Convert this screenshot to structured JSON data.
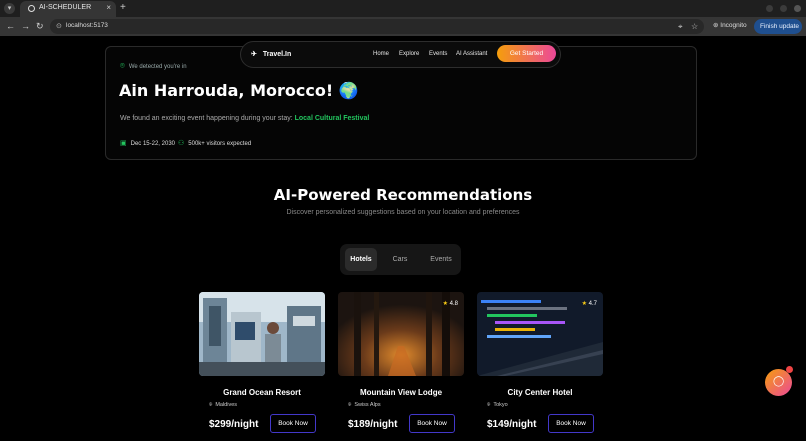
{
  "browser": {
    "tab_title": "AI-SCHEDULER",
    "url": "localhost:5173",
    "incognito_label": "Incognito",
    "finish_update_label": "Finish update"
  },
  "navbar": {
    "brand": "Travel.In",
    "links": [
      "Home",
      "Explore",
      "Events",
      "AI Assistant"
    ],
    "cta": "Get Started"
  },
  "hero": {
    "detected_label": "We detected you're in",
    "location_title": "Ain Harrouda, Morocco! 🌍",
    "event_text": "We found an exciting event happening during your stay:",
    "event_name": "Local Cultural Festival",
    "dates": "Dec 15-22, 2030",
    "visitors": "500k+ visitors expected"
  },
  "recommendations": {
    "title": "AI-Powered Recommendations",
    "subtitle": "Discover personalized suggestions based on your location and preferences",
    "tabs": [
      "Hotels",
      "Cars",
      "Events"
    ],
    "active_tab": "Hotels",
    "book_label": "Book Now",
    "cards": [
      {
        "name": "Grand Ocean Resort",
        "location": "Maldives",
        "price": "$299/night",
        "rating": ""
      },
      {
        "name": "Mountain View Lodge",
        "location": "Swiss Alps",
        "price": "$189/night",
        "rating": "4.8"
      },
      {
        "name": "City Center Hotel",
        "location": "Tokyo",
        "price": "$149/night",
        "rating": "4.7"
      }
    ]
  },
  "colors": {
    "accent_green": "#22c55e",
    "gradient_start": "#f59e0b",
    "gradient_end": "#ec4899",
    "button_border": "#4338ca"
  }
}
